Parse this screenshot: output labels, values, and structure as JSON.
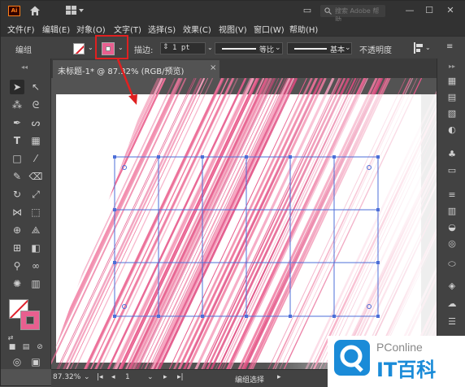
{
  "title_bar": {
    "app_logo": "Ai",
    "search_placeholder": "搜索 Adobe 帮助",
    "win_controls": [
      "—",
      "☐",
      "✕"
    ]
  },
  "menu": [
    "文件(F)",
    "编辑(E)",
    "对象(O)",
    "文字(T)",
    "选择(S)",
    "效果(C)",
    "视图(V)",
    "窗口(W)",
    "帮助(H)"
  ],
  "control_bar": {
    "mode_label": "编组",
    "stroke_label": "描边:",
    "stroke_value": "1 pt",
    "profile1_label": "等比",
    "profile2_label": "基本",
    "opacity_label": "不透明度",
    "fill_color": "#ffffff",
    "stroke_color": "#e85f8f"
  },
  "tab": {
    "label": "未标题-1* @ 87.32% (RGB/预览)",
    "close": "×"
  },
  "status_bar": {
    "zoom": "87.32%",
    "page": "1",
    "status_text": "编组选择"
  },
  "watermark": {
    "small": "PConline",
    "big": "IT百科"
  },
  "colors": {
    "accent_pink": "#e85f8f",
    "highlight_red": "#e02020",
    "selection_blue": "#4d6fd8"
  }
}
